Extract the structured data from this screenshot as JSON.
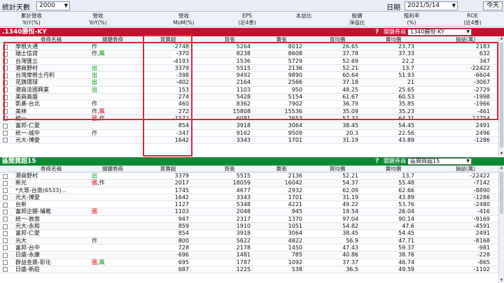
{
  "topbar": {
    "days_label": "統計天數",
    "days_value": "2000",
    "date_label": "日期",
    "date_value": "2021/5/14",
    "today_button": "今天"
  },
  "kpis": [
    {
      "line1": "累計營收",
      "line2": "YoY(%)"
    },
    {
      "line1": "營收",
      "line2": "YoY(%)"
    },
    {
      "line1": "營收",
      "line2": "MoM(%)"
    },
    {
      "line1": "EPS",
      "line2": "(近4季)"
    },
    {
      "line1": "本益比",
      "line2": ""
    },
    {
      "line1": "股價",
      "line2": "淨值比"
    },
    {
      "line1": "殖利率",
      "line2": "(%)"
    },
    {
      "line1": "ROE",
      "line2": "(近4季)"
    }
  ],
  "panel1": {
    "title": ".1340勝悅-KY",
    "help": "?",
    "key_label": "關鍵券商",
    "key_value": "1340勝悅-KY",
    "columns": [
      "券商名稱",
      "關鍵券商",
      "買賣超",
      "買張",
      "賣張",
      "買均價",
      "賣均價",
      "損益(萬)"
    ],
    "rows": [
      {
        "name": "摩根大通",
        "tags": [
          {
            "t": "作",
            "c": "k"
          }
        ],
        "net": "-2748",
        "buy": "5264",
        "sell": "8012",
        "avg_buy": "26.65",
        "avg_sell": "23.73",
        "pl": "2183"
      },
      {
        "name": "瑞士信貸",
        "tags": [
          {
            "t": "作",
            "c": "k"
          },
          {
            "t": ",",
            "c": "k"
          },
          {
            "t": "飆",
            "c": "g"
          }
        ],
        "net": "-370",
        "buy": "8238",
        "sell": "8608",
        "avg_buy": "37.78",
        "avg_sell": "37.33",
        "pl": "632"
      },
      {
        "name": "台灣匯立",
        "tags": [],
        "net": "-4193",
        "buy": "1536",
        "sell": "5729",
        "avg_buy": "52.69",
        "avg_sell": "22.2",
        "pl": "347"
      },
      {
        "name": "港商野村",
        "tags": [
          {
            "t": "出",
            "c": "g"
          }
        ],
        "net": "3379",
        "buy": "5515",
        "sell": "2136",
        "avg_buy": "52.21",
        "avg_sell": "13.7",
        "pl": "-22422"
      },
      {
        "name": "台灣摩根士丹利",
        "tags": [
          {
            "t": "出",
            "c": "g"
          }
        ],
        "net": "-398",
        "buy": "9492",
        "sell": "9890",
        "avg_buy": "60.64",
        "avg_sell": "51.93",
        "pl": "-6604"
      },
      {
        "name": "花旗環球",
        "tags": [
          {
            "t": "出",
            "c": "g"
          }
        ],
        "net": "-402",
        "buy": "2164",
        "sell": "2566",
        "avg_buy": "37.18",
        "avg_sell": "21",
        "pl": "-3067"
      },
      {
        "name": "港商法國興業",
        "tags": [
          {
            "t": "出",
            "c": "g"
          }
        ],
        "net": "153",
        "buy": "1103",
        "sell": "950",
        "avg_buy": "48.25",
        "avg_sell": "25.65",
        "pl": "-2729"
      },
      {
        "name": "美商高盛",
        "tags": [],
        "net": "274",
        "buy": "5428",
        "sell": "5154",
        "avg_buy": "61.67",
        "avg_sell": "60.53",
        "pl": "-1998"
      },
      {
        "name": "凱基-台北",
        "tags": [
          {
            "t": "作",
            "c": "k"
          }
        ],
        "net": "460",
        "buy": "8362",
        "sell": "7902",
        "avg_buy": "36.79",
        "avg_sell": "35.85",
        "pl": "-1966"
      },
      {
        "name": "美林",
        "tags": [
          {
            "t": "作",
            "c": "k"
          },
          {
            "t": ",",
            "c": "k"
          },
          {
            "t": "飆",
            "c": "o"
          }
        ],
        "net": "272",
        "buy": "15808",
        "sell": "15536",
        "avg_buy": "35.09",
        "avg_sell": "35.23",
        "pl": "-461"
      },
      {
        "name": "統一",
        "tags": [
          {
            "t": "國",
            "c": "o"
          },
          {
            "t": ",作",
            "c": "k"
          }
        ],
        "net": "-1572",
        "buy": "6081",
        "sell": "7653",
        "avg_buy": "57.32",
        "avg_sell": "64.31",
        "pl": "12754"
      },
      {
        "name": "富邦-仁愛",
        "tags": [],
        "net": "854",
        "buy": "3918",
        "sell": "3064",
        "avg_buy": "38.45",
        "avg_sell": "54.45",
        "pl": "2491"
      },
      {
        "name": "統一-城中",
        "tags": [
          {
            "t": "作",
            "c": "k"
          }
        ],
        "net": "-347",
        "buy": "9162",
        "sell": "9509",
        "avg_buy": "20.3",
        "avg_sell": "22.56",
        "pl": "2496"
      },
      {
        "name": "元大-博愛",
        "tags": [],
        "net": "1642",
        "buy": "3343",
        "sell": "1701",
        "avg_buy": "31.19",
        "avg_sell": "43.89",
        "pl": "-1286"
      }
    ]
  },
  "panel2": {
    "title": "區間買超15",
    "help": "?",
    "key_label": "關鍵券商",
    "key_value": "區間買超15",
    "columns": [
      "券商名稱",
      "關鍵券商",
      "買賣超",
      "買張",
      "賣張",
      "買均價",
      "賣均價",
      "損益(萬)"
    ],
    "rows": [
      {
        "name": "港商野村",
        "tags": [
          {
            "t": "出",
            "c": "g"
          }
        ],
        "net": "3379",
        "buy": "5515",
        "sell": "2136",
        "avg_buy": "52.21",
        "avg_sell": "13.7",
        "pl": "-22422"
      },
      {
        "name": "新光",
        "tags": [
          {
            "t": "國",
            "c": "o"
          },
          {
            "t": ",作",
            "c": "k"
          }
        ],
        "net": "2017",
        "buy": "18059",
        "sell": "16042",
        "avg_buy": "54.37",
        "avg_sell": "55.48",
        "pl": "-7142"
      },
      {
        "name": "*大眾-台南(6533)...",
        "tags": [],
        "net": "1745",
        "buy": "4677",
        "sell": "2932",
        "avg_buy": "62.09",
        "avg_sell": "62.66",
        "pl": "-8890"
      },
      {
        "name": "元大-博愛",
        "tags": [],
        "net": "1642",
        "buy": "3343",
        "sell": "1701",
        "avg_buy": "31.19",
        "avg_sell": "43.89",
        "pl": "-1286"
      },
      {
        "name": "台新",
        "tags": [],
        "net": "1127",
        "buy": "5348",
        "sell": "4221",
        "avg_buy": "49.22",
        "avg_sell": "53.76",
        "pl": "-2480"
      },
      {
        "name": "富邦企銀-埔墘",
        "tags": [
          {
            "t": "國",
            "c": "o"
          }
        ],
        "net": "1103",
        "buy": "2048",
        "sell": "945",
        "avg_buy": "19.54",
        "avg_sell": "26.04",
        "pl": "-416"
      },
      {
        "name": "統一-敦南",
        "tags": [],
        "net": "947",
        "buy": "2317",
        "sell": "1370",
        "avg_buy": "97.04",
        "avg_sell": "90.14",
        "pl": "-9169"
      },
      {
        "name": "元大-永和",
        "tags": [],
        "net": "859",
        "buy": "1910",
        "sell": "1051",
        "avg_buy": "54.82",
        "avg_sell": "47.6",
        "pl": "-4591"
      },
      {
        "name": "富邦-仁愛",
        "tags": [],
        "net": "854",
        "buy": "3918",
        "sell": "3064",
        "avg_buy": "38.45",
        "avg_sell": "54.45",
        "pl": "2491"
      },
      {
        "name": "元大",
        "tags": [
          {
            "t": "作",
            "c": "k"
          }
        ],
        "net": "800",
        "buy": "5622",
        "sell": "4822",
        "avg_buy": "56.9",
        "avg_sell": "47.71",
        "pl": "-8168"
      },
      {
        "name": "富邦-台中",
        "tags": [],
        "net": "728",
        "buy": "2178",
        "sell": "1450",
        "avg_buy": "47.43",
        "avg_sell": "59.37",
        "pl": "-981"
      },
      {
        "name": "日盛-永康",
        "tags": [],
        "net": "696",
        "buy": "1481",
        "sell": "785",
        "avg_buy": "40.86",
        "avg_sell": "38.76",
        "pl": "-228"
      },
      {
        "name": "群益金鼎-彰化",
        "tags": [
          {
            "t": "國",
            "c": "o"
          },
          {
            "t": ",",
            "c": "k"
          },
          {
            "t": "飆",
            "c": "g"
          }
        ],
        "net": "695",
        "buy": "1787",
        "sell": "1092",
        "avg_buy": "37.37",
        "avg_sell": "46.74",
        "pl": "-865"
      },
      {
        "name": "日盛-新莊",
        "tags": [],
        "net": "687",
        "buy": "1225",
        "sell": "538",
        "avg_buy": "36.5",
        "avg_sell": "49.59",
        "pl": "-1102"
      }
    ]
  },
  "colors": {
    "panel1_bar": "#c8102e",
    "panel2_bar": "#0f8a34",
    "highlight": "#d6283a"
  }
}
